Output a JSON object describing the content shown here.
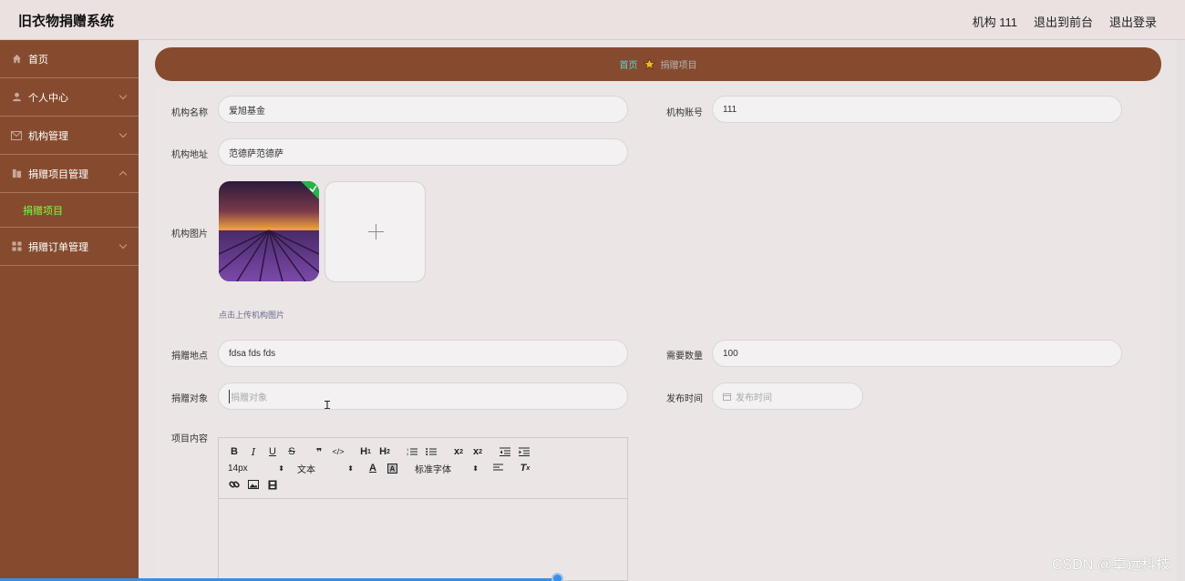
{
  "app": {
    "title": "旧衣物捐赠系统"
  },
  "header": {
    "user_label": "机构 111",
    "front_label": "退出到前台",
    "logout_label": "退出登录"
  },
  "sidebar": {
    "items": [
      {
        "label": "首页",
        "icon": "home-icon"
      },
      {
        "label": "个人中心",
        "icon": "user-icon"
      },
      {
        "label": "机构管理",
        "icon": "mail-icon"
      },
      {
        "label": "捐赠项目管理",
        "icon": "book-icon"
      },
      {
        "label": "捐赠订单管理",
        "icon": "grid-icon"
      }
    ],
    "submenu_active": "捐赠项目"
  },
  "breadcrumb": {
    "home": "首页",
    "current": "捐赠项目"
  },
  "form": {
    "org_name_label": "机构名称",
    "org_name_value": "爱旭基金",
    "org_account_label": "机构账号",
    "org_account_value": "111",
    "org_address_label": "机构地址",
    "org_address_value": "范德萨范德萨",
    "org_image_label": "机构图片",
    "upload_tip": "点击上传机构图片",
    "place_label": "捐赠地点",
    "place_value": "fdsa fds fds",
    "quantity_label": "需要数量",
    "quantity_value": "100",
    "target_label": "捐赠对象",
    "target_placeholder": "捐赠对象",
    "publish_label": "发布时间",
    "publish_placeholder": "发布时间",
    "content_label": "项目内容"
  },
  "editor": {
    "font_size": "14px",
    "block_type": "文本",
    "font_family": "标准字体"
  },
  "watermark": "CSDN @卓远科技"
}
